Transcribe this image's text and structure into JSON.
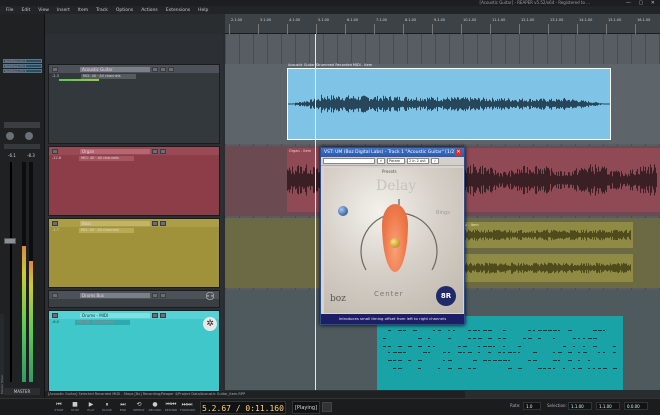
{
  "window": {
    "title": "[Acoustic Guitar] - REAPER v5.52/x64 - Registered to ...",
    "controls": "— ▢ ✕"
  },
  "menu": [
    "File",
    "Edit",
    "View",
    "Insert",
    "Item",
    "Track",
    "Options",
    "Actions",
    "Extensions",
    "Help"
  ],
  "mixer": {
    "tabs": [
      "ReaTrans Ch 1",
      "ReaTrans Ch 2",
      "ReaTrans Ch 3"
    ],
    "master_label": "MASTER",
    "side_label": "Master Mixer",
    "db_left": "-6.1",
    "db_right": "-8.3",
    "peak_left": 0.62,
    "peak_right": 0.55
  },
  "master_track": {
    "name": "master"
  },
  "tracks": [
    {
      "name": "Acoustic Guitar",
      "io": "MCI: 40 · All channels",
      "vol": "-2.3",
      "color": "#4a5055"
    },
    {
      "name": "Organ",
      "io": "MCI: 40 · All channels",
      "vol": "-12.8",
      "color": "#b0454f"
    },
    {
      "name": "Bass",
      "io": "MCI: 40 · All channels",
      "vol": "-1.7",
      "color": "#b5a440"
    },
    {
      "name": "Drums Bus",
      "io": "",
      "vol": "",
      "color": "#4a5055"
    },
    {
      "name": "Drums - MIDI",
      "io": "MIDI IN · All channels",
      "vol": "-6.0",
      "color": "#3fc7c9"
    }
  ],
  "ruler": {
    "labels": [
      "2.1.00",
      "3.1.00",
      "4.1.00",
      "5.1.00",
      "6.1.00",
      "7.1.00",
      "8.1.00",
      "9.1.00",
      "10.1.00",
      "11.1.00",
      "12.1.00",
      "13.1.00",
      "14.1.00",
      "15.1.00",
      "16.1.00"
    ]
  },
  "items": [
    {
      "label": "Acoustic Guitar Strummed Recorded MIDI - Item"
    },
    {
      "label": "Organ - Item"
    },
    {
      "label": "Bass - Item"
    },
    {
      "label": "Drums MIDI - Item"
    }
  ],
  "plugin": {
    "title": "VST: UM (Boz Digital Labs) - Track 1 \"Acoustic Guitar\" [1/2]",
    "presets_label": "Presets",
    "param_label": "Param",
    "io_label": "2 in 2 out",
    "brand": "boz",
    "logo": "8R",
    "knob_label": "Center",
    "top_label": "Delay",
    "right_label": "Rings",
    "status": "Introduces small timing offset from left to right channels"
  },
  "status_bar": {
    "text": "[Acoustic Guitar] Selected Recorded MIDI - Steps [8x] Recording/Reaper 4/Project Data/Acoustic Guitar_Item.RPP"
  },
  "transport": {
    "buttons": [
      {
        "glyph": "⏮",
        "label": "START"
      },
      {
        "glyph": "■",
        "label": "STOP"
      },
      {
        "glyph": "▶",
        "label": "PLAY"
      },
      {
        "glyph": "⏸",
        "label": "PAUSE"
      },
      {
        "glyph": "⏭",
        "label": "END"
      },
      {
        "glyph": "⟲",
        "label": "REPEAT"
      },
      {
        "glyph": "●",
        "label": "RECORD"
      },
      {
        "glyph": "⏮⏮",
        "label": "REWIND"
      },
      {
        "glyph": "⏭⏭",
        "label": "FORWARD"
      }
    ],
    "time": "5.2.67 / 0:11.160",
    "state": "[Playing]",
    "rate_label": "Rate:",
    "rate_value": "1.0",
    "selection_label": "Selection:",
    "sel_start": "1.1.00",
    "sel_end": "1.1.00",
    "sel_len": "0.0.00"
  },
  "colors": {
    "guitar_item": "#7fc3e6",
    "organ_lane": "#8f4a55",
    "bass_lane": "#8f8a44",
    "drums_item": "#1aa3a6"
  }
}
